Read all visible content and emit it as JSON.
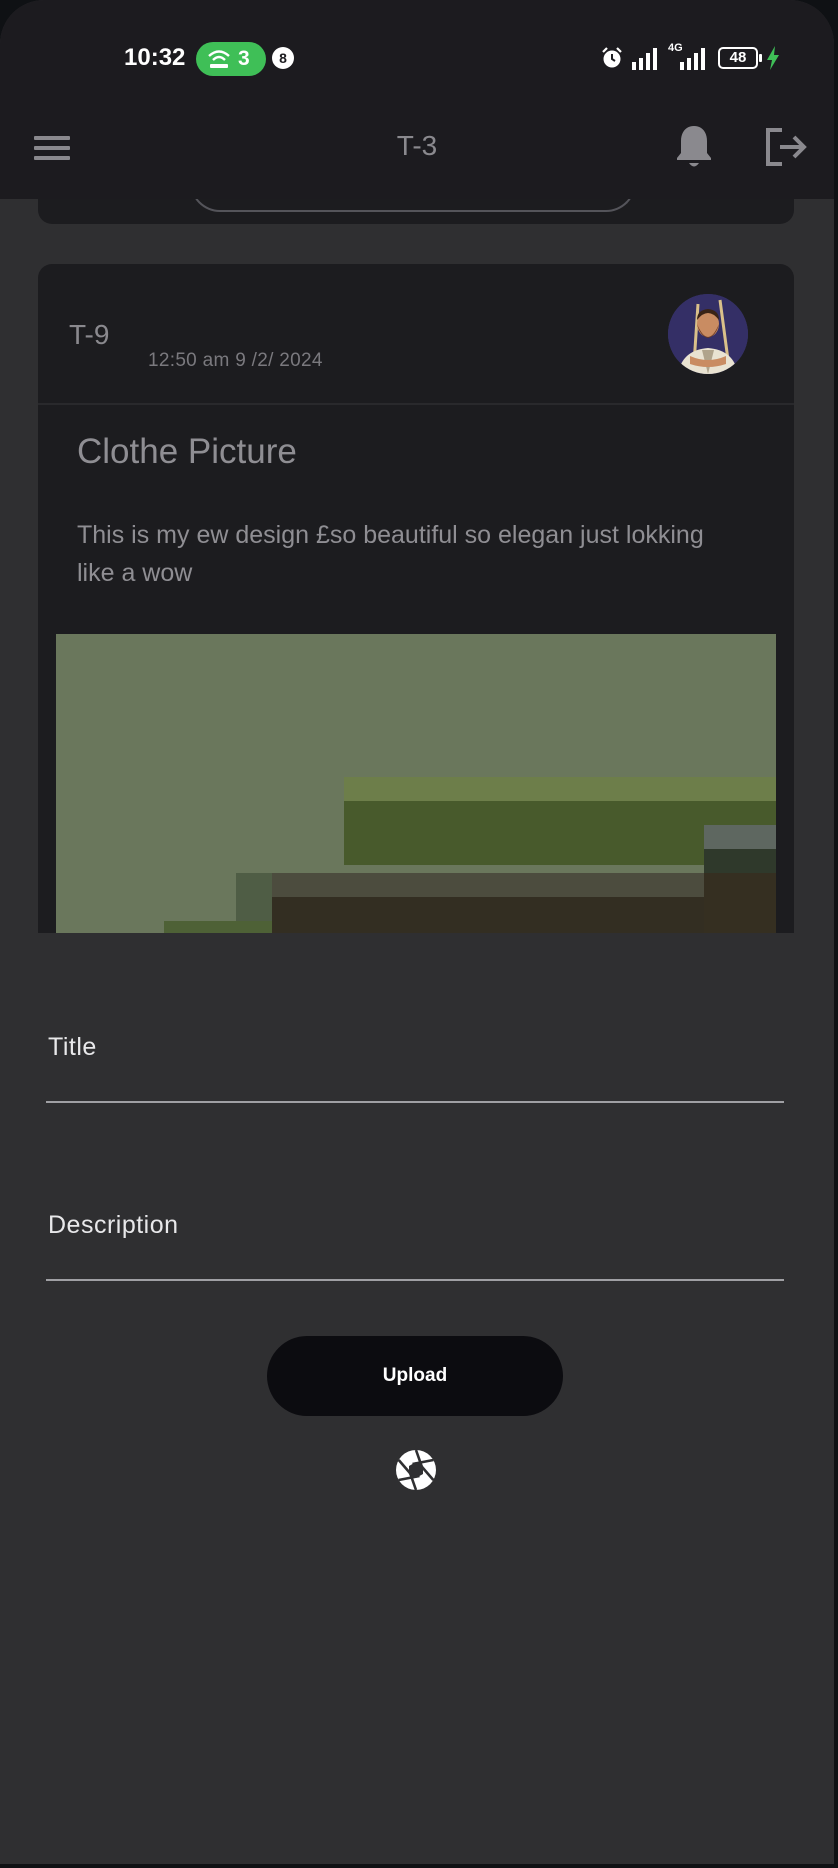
{
  "status_bar": {
    "time": "10:32",
    "hotspot_count": "3",
    "notification_count": "8",
    "network": "4G",
    "battery": "48"
  },
  "app_bar": {
    "title": "T-3",
    "menu_icon": "menu-icon",
    "notification_icon": "bell-icon",
    "logout_icon": "logout-icon"
  },
  "post": {
    "author": "T-9",
    "time": "12:50 am  9 /2/ 2024",
    "title": "Clothe Picture",
    "description": "This is my ew design £so beautiful so elegan just lokking like a wow"
  },
  "form": {
    "title_label": "Title",
    "description_label": "Description",
    "upload_label": "Upload",
    "camera_icon": "camera-shutter-icon"
  },
  "colors": {
    "background": "#2f2f31",
    "bar": "#1c1b1f",
    "card": "#1c1c1f",
    "hotspot": "#3fbf57",
    "charging": "#3fbf57",
    "button": "#0c0c10"
  }
}
